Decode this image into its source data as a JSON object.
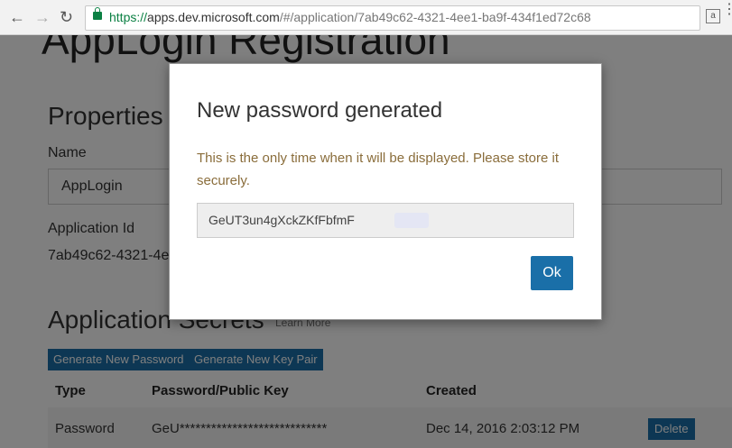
{
  "browser": {
    "url_secure": "https://",
    "url_host": "apps.dev.microsoft.com",
    "url_path": "/#/application/7ab49c62-4321-4ee1-ba9f-434f1ed72c68"
  },
  "page": {
    "title": "AppLogin Registration",
    "properties_heading": "Properties",
    "name_label": "Name",
    "name_value": "AppLogin",
    "app_id_label": "Application Id",
    "app_id_value": "7ab49c62-4321-4e",
    "secrets_heading": "Application Secrets",
    "learn_more": "Learn More",
    "generate_password_label": "Generate New Password",
    "generate_keypair_label": "Generate New Key Pair",
    "table": {
      "headers": [
        "Type",
        "Password/Public Key",
        "Created"
      ],
      "rows": [
        {
          "type": "Password",
          "key": "GeU****************************",
          "created": "Dec 14, 2016 2:03:12 PM",
          "action": "Delete"
        }
      ]
    }
  },
  "modal": {
    "title": "New password generated",
    "message": "This is the only time when it will be displayed. Please store it securely.",
    "password_value": "GeUT3un4gXckZKfFbfmF",
    "ok_label": "Ok"
  }
}
